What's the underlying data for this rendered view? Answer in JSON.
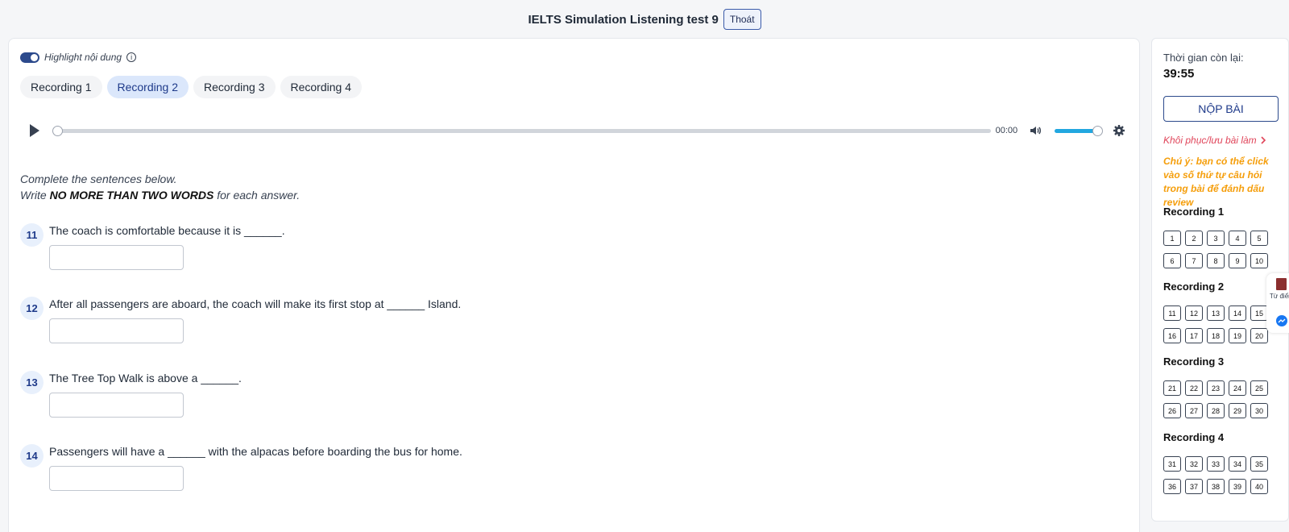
{
  "header": {
    "title": "IELTS Simulation Listening test 9",
    "exit_label": "Thoát"
  },
  "highlight": {
    "label": "Highlight nội dung",
    "enabled": true,
    "info_glyph": "i"
  },
  "tabs": [
    {
      "label": "Recording 1",
      "active": false
    },
    {
      "label": "Recording 2",
      "active": true
    },
    {
      "label": "Recording 3",
      "active": false
    },
    {
      "label": "Recording 4",
      "active": false
    }
  ],
  "player": {
    "time": "00:00",
    "progress": 0,
    "volume": 1.0
  },
  "instructions": {
    "line1": "Complete the sentences below.",
    "line2_pre": "Write ",
    "line2_bold": "NO MORE THAN TWO WORDS",
    "line2_post": " for each answer."
  },
  "questions": [
    {
      "num": "11",
      "text": "The coach is comfortable because it is ______.",
      "answer": ""
    },
    {
      "num": "12",
      "text": "After all passengers are aboard, the coach will make its first stop at ______ Island.",
      "answer": ""
    },
    {
      "num": "13",
      "text": "The Tree Top Walk is above a ______.",
      "answer": ""
    },
    {
      "num": "14",
      "text": "Passengers will have a ______ with the alpacas before boarding the bus for home.",
      "answer": ""
    }
  ],
  "sidebar": {
    "time_label": "Thời gian còn lại:",
    "time_value": "39:55",
    "submit_label": "NỘP BÀI",
    "restore_label": "Khôi phục/lưu bài làm",
    "note": "Chú ý: bạn có thể click vào số thứ tự câu hỏi trong bài để đánh dấu review",
    "recordings": [
      {
        "title": "Recording 1",
        "numbers": [
          "1",
          "2",
          "3",
          "4",
          "5",
          "6",
          "7",
          "8",
          "9",
          "10"
        ]
      },
      {
        "title": "Recording 2",
        "numbers": [
          "11",
          "12",
          "13",
          "14",
          "15",
          "16",
          "17",
          "18",
          "19",
          "20"
        ]
      },
      {
        "title": "Recording 3",
        "numbers": [
          "21",
          "22",
          "23",
          "24",
          "25",
          "26",
          "27",
          "28",
          "29",
          "30"
        ]
      },
      {
        "title": "Recording 4",
        "numbers": [
          "31",
          "32",
          "33",
          "34",
          "35",
          "36",
          "37",
          "38",
          "39",
          "40"
        ]
      }
    ]
  },
  "floating": {
    "dict_label": "Từ điển"
  },
  "colors": {
    "accent": "#2c4a8c",
    "active_tab_bg": "#dbe7fb",
    "volume": "#22a7e0",
    "link_red": "#e0455a",
    "note_orange": "#f59e0b"
  }
}
